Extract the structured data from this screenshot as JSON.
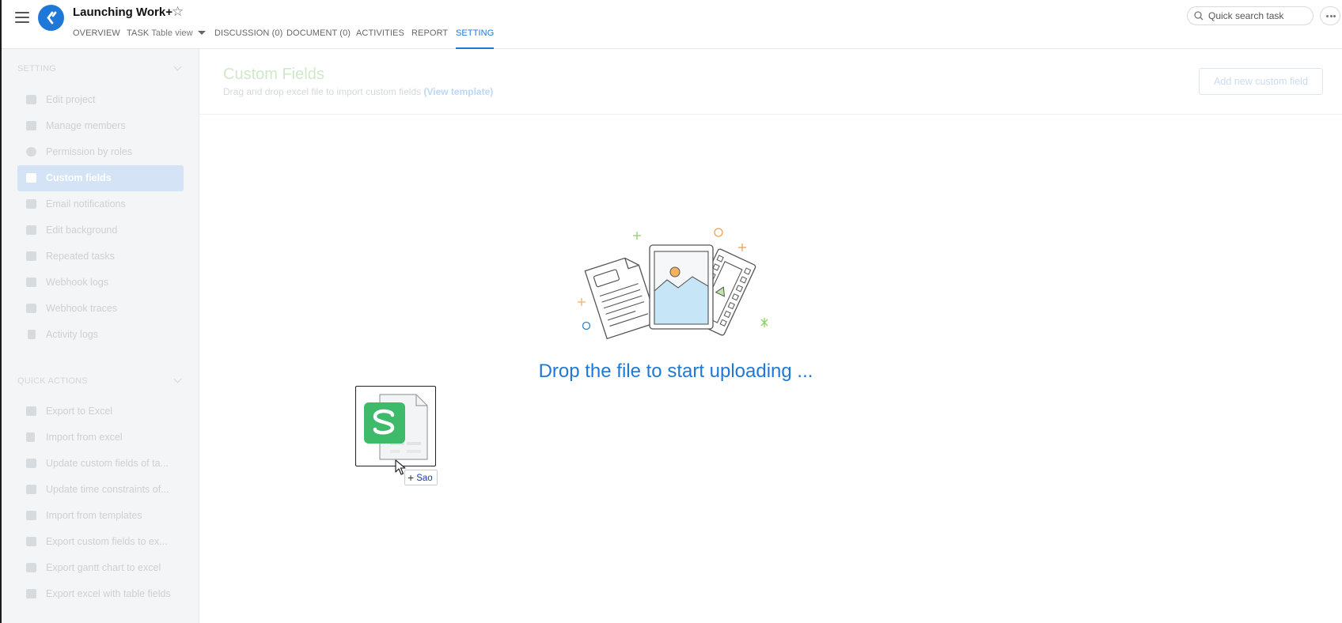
{
  "header": {
    "project_title": "Launching Work+",
    "tabs": [
      {
        "label": "OVERVIEW"
      },
      {
        "label": "TASK",
        "sub": "Table view"
      },
      {
        "label": "DISCUSSION (0)"
      },
      {
        "label": "DOCUMENT (0)"
      },
      {
        "label": "ACTIVITIES"
      },
      {
        "label": "REPORT"
      },
      {
        "label": "SETTING"
      }
    ],
    "active_tab": "SETTING",
    "search_placeholder": "Quick search task"
  },
  "sidebar": {
    "setting_title": "SETTING",
    "setting_items": [
      {
        "label": "Edit project",
        "icon": "list-icon"
      },
      {
        "label": "Manage members",
        "icon": "person-icon"
      },
      {
        "label": "Permission by roles",
        "icon": "info-icon"
      },
      {
        "label": "Custom fields",
        "icon": "document-icon"
      },
      {
        "label": "Email notifications",
        "icon": "envelope-icon"
      },
      {
        "label": "Edit background",
        "icon": "edit-icon"
      },
      {
        "label": "Repeated tasks",
        "icon": "calendar-icon"
      },
      {
        "label": "Webhook logs",
        "icon": "flag-icon"
      },
      {
        "label": "Webhook traces",
        "icon": "flag-icon"
      },
      {
        "label": "Activity logs",
        "icon": "hourglass-icon"
      }
    ],
    "active_item": "Custom fields",
    "quick_title": "QUICK ACTIONS",
    "quick_items": [
      {
        "label": "Export to Excel",
        "icon": "export-icon"
      },
      {
        "label": "Import from excel",
        "icon": "file-icon"
      },
      {
        "label": "Update custom fields of ta...",
        "icon": "cube-icon"
      },
      {
        "label": "Update time constraints of...",
        "icon": "cube-icon"
      },
      {
        "label": "Import from templates",
        "icon": "folder-icon"
      },
      {
        "label": "Export custom fields to ex...",
        "icon": "export-icon"
      },
      {
        "label": "Export gantt chart to excel",
        "icon": "export-icon"
      },
      {
        "label": "Export excel with table fields",
        "icon": "export-icon"
      }
    ]
  },
  "main": {
    "title": "Custom Fields",
    "subtitle": "Drag and drop excel file to import custom fields",
    "template_link": "(View template)",
    "add_button": "Add new custom field",
    "drop_message": "Drop the file to start uploading ...",
    "drag_tooltip": "Sao"
  },
  "colors": {
    "accent": "#1e78d8",
    "active_sidebar_bg": "#d4e3f5",
    "file_icon_green": "#3dba6a"
  }
}
